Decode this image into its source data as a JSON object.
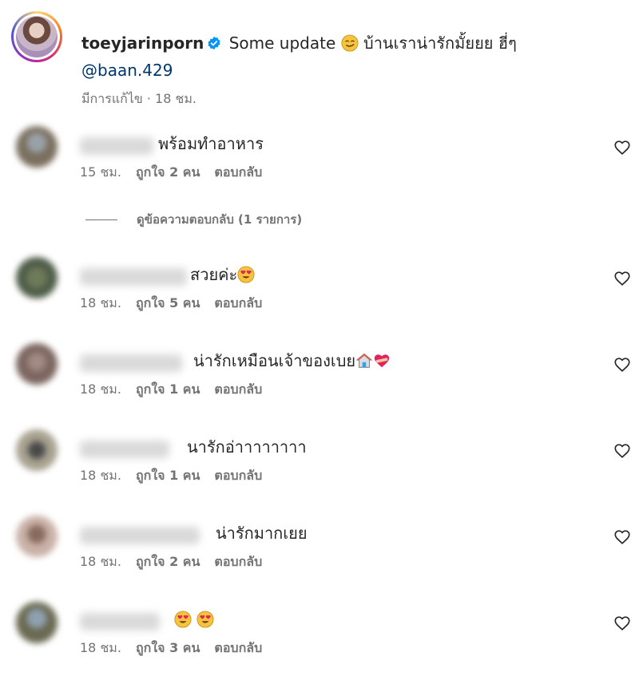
{
  "caption": {
    "username": "toeyjarinporn",
    "text_before": "Some update",
    "text_after": "บ้านเราน่ารักมั้ยยย ฮี่ๆ",
    "mention": "@baan.429",
    "meta": "มีการแก้ไข · 18 ชม."
  },
  "comments": [
    {
      "text": "พร้อมทำอาหาร",
      "time": "15 ชม.",
      "likes": "ถูกใจ 2 คน",
      "reply": "ตอบกลับ"
    },
    {
      "text": "สวยค่ะ",
      "time": "18 ชม.",
      "likes": "ถูกใจ 5 คน",
      "reply": "ตอบกลับ"
    },
    {
      "text": "น่ารักเหมือนเจ้าของเบย",
      "time": "18 ชม.",
      "likes": "ถูกใจ 1 คน",
      "reply": "ตอบกลับ"
    },
    {
      "text": "นารักอ่าาาาาาาา",
      "time": "18 ชม.",
      "likes": "ถูกใจ 1 คน",
      "reply": "ตอบกลับ"
    },
    {
      "text": "น่ารักมากเยย",
      "time": "18 ชม.",
      "likes": "ถูกใจ 2 คน",
      "reply": "ตอบกลับ"
    },
    {
      "text": "",
      "time": "18 ชม.",
      "likes": "ถูกใจ 3 คน",
      "reply": "ตอบกลับ"
    }
  ],
  "view_replies": "ดูข้อความตอบกลับ (1 รายการ)",
  "icons": {
    "verified": "verified-badge-icon",
    "heart": "heart-outline-icon"
  },
  "colors": {
    "link": "#00376b",
    "verified": "#0095f6",
    "meta": "#737373",
    "text": "#262626"
  }
}
